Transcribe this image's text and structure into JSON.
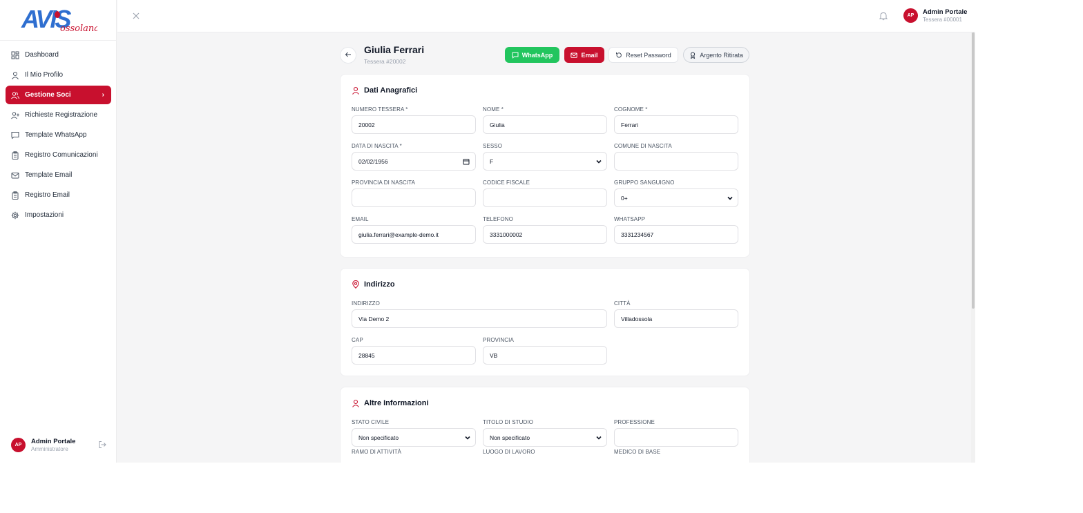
{
  "brand": {
    "logo_text": "AVIS",
    "logo_script": "ossolana",
    "logo_blue": "#2f6fd0",
    "logo_red": "#c8102e"
  },
  "sidebar": {
    "items": [
      {
        "label": "Dashboard",
        "icon": "dashboard-icon"
      },
      {
        "label": "Il Mio Profilo",
        "icon": "user-icon"
      },
      {
        "label": "Gestione Soci",
        "icon": "users-icon",
        "active": true
      },
      {
        "label": "Richieste Registrazione",
        "icon": "user-plus-icon"
      },
      {
        "label": "Template WhatsApp",
        "icon": "message-icon"
      },
      {
        "label": "Registro Comunicazioni",
        "icon": "clipboard-icon"
      },
      {
        "label": "Template Email",
        "icon": "mail-icon"
      },
      {
        "label": "Registro Email",
        "icon": "clipboard-icon"
      },
      {
        "label": "Impostazioni",
        "icon": "gear-icon"
      }
    ],
    "user": {
      "initials": "AP",
      "name": "Admin Portale",
      "role": "Amministratore"
    }
  },
  "header": {
    "user": {
      "initials": "AP",
      "name": "Admin Portale",
      "card": "Tessera #00001"
    }
  },
  "page": {
    "title": "Giulia Ferrari",
    "subtitle": "Tessera #20002",
    "buttons": {
      "whatsapp": "WhatsApp",
      "email": "Email",
      "reset": "Reset Password",
      "argento": "Argento Ritirata"
    }
  },
  "anagrafica": {
    "title": "Dati Anagrafici",
    "fields": {
      "numero_tessera": {
        "label": "NUMERO TESSERA *",
        "value": "20002"
      },
      "nome": {
        "label": "NOME *",
        "value": "Giulia"
      },
      "cognome": {
        "label": "COGNOME *",
        "value": "Ferrari"
      },
      "data_nascita": {
        "label": "DATA DI NASCITA *",
        "value": "02/02/1956"
      },
      "sesso": {
        "label": "SESSO",
        "value": "F"
      },
      "comune_nascita": {
        "label": "COMUNE DI NASCITA",
        "value": ""
      },
      "provincia_nascita": {
        "label": "PROVINCIA DI NASCITA",
        "value": ""
      },
      "codice_fiscale": {
        "label": "CODICE FISCALE",
        "value": ""
      },
      "gruppo_sanguigno": {
        "label": "GRUPPO SANGUIGNO",
        "value": "0+"
      },
      "email": {
        "label": "EMAIL",
        "value": "giulia.ferrari@example-demo.it"
      },
      "telefono": {
        "label": "TELEFONO",
        "value": "3331000002"
      },
      "whatsapp": {
        "label": "WHATSAPP",
        "value": "3331234567"
      }
    }
  },
  "indirizzo": {
    "title": "Indirizzo",
    "fields": {
      "indirizzo": {
        "label": "INDIRIZZO",
        "value": "Via Demo 2"
      },
      "citta": {
        "label": "CITTÀ",
        "value": "Villadossola"
      },
      "cap": {
        "label": "CAP",
        "value": "28845"
      },
      "provincia": {
        "label": "PROVINCIA",
        "value": "VB"
      }
    }
  },
  "altre": {
    "title": "Altre Informazioni",
    "fields": {
      "stato_civile": {
        "label": "STATO CIVILE",
        "value": "Non specificato"
      },
      "titolo_studio": {
        "label": "TITOLO DI STUDIO",
        "value": "Non specificato"
      },
      "professione": {
        "label": "PROFESSIONE",
        "value": ""
      },
      "ramo_attivita": {
        "label": "RAMO DI ATTIVITÀ"
      },
      "luogo_lavoro": {
        "label": "LUOGO DI LAVORO"
      },
      "medico_base": {
        "label": "MEDICO DI BASE"
      }
    }
  },
  "colors": {
    "accent": "#c8102e",
    "whatsapp": "#22c55e"
  }
}
